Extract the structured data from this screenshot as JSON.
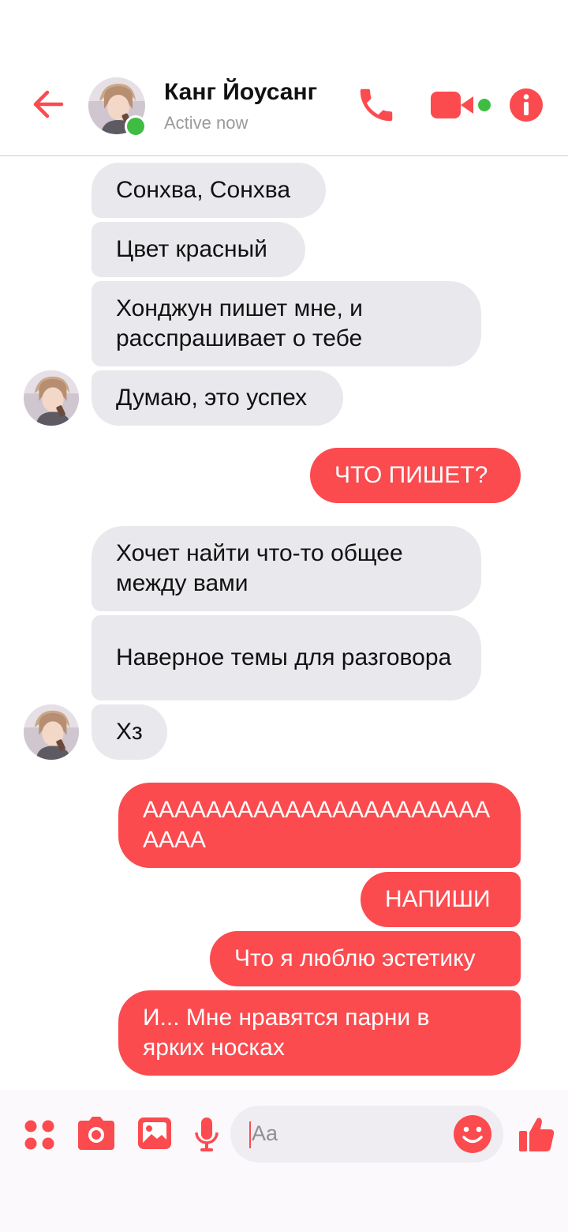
{
  "header": {
    "contact_name": "Канг Йоусанг",
    "status": "Active now",
    "avatar_icon": "avatar-photo",
    "back_icon": "back-arrow-icon",
    "call_icon": "phone-icon",
    "video_icon": "video-camera-icon",
    "info_icon": "info-icon"
  },
  "messages": [
    {
      "from": "them",
      "text": "Сонхва, Сонхва"
    },
    {
      "from": "them",
      "text": "Цвет красный"
    },
    {
      "from": "them",
      "text": "Хонджун пишет мне, и расспрашивает о тебе"
    },
    {
      "from": "them",
      "text": "Думаю, это успех"
    },
    {
      "from": "me",
      "text": "ЧТО ПИШЕТ?"
    },
    {
      "from": "them",
      "text": "Хочет найти что-то общее между вами"
    },
    {
      "from": "them",
      "text": "Наверное темы для разговора"
    },
    {
      "from": "them",
      "text": "Хз"
    },
    {
      "from": "me",
      "text": "АААААААААААААААААААААААААА"
    },
    {
      "from": "me",
      "text": "НАПИШИ"
    },
    {
      "from": "me",
      "text": "Что я люблю эстетику"
    },
    {
      "from": "me",
      "text": "И... Мне нравятся парни в ярких носках"
    }
  ],
  "composer": {
    "placeholder": "Aa",
    "tools": [
      "apps-icon",
      "camera-icon",
      "gallery-icon",
      "microphone-icon",
      "emoji-icon",
      "thumbs-up-icon"
    ]
  },
  "colors": {
    "accent": "#fb4b4f",
    "incoming_bubble": "#e9e8ec",
    "online": "#3fbd43"
  }
}
